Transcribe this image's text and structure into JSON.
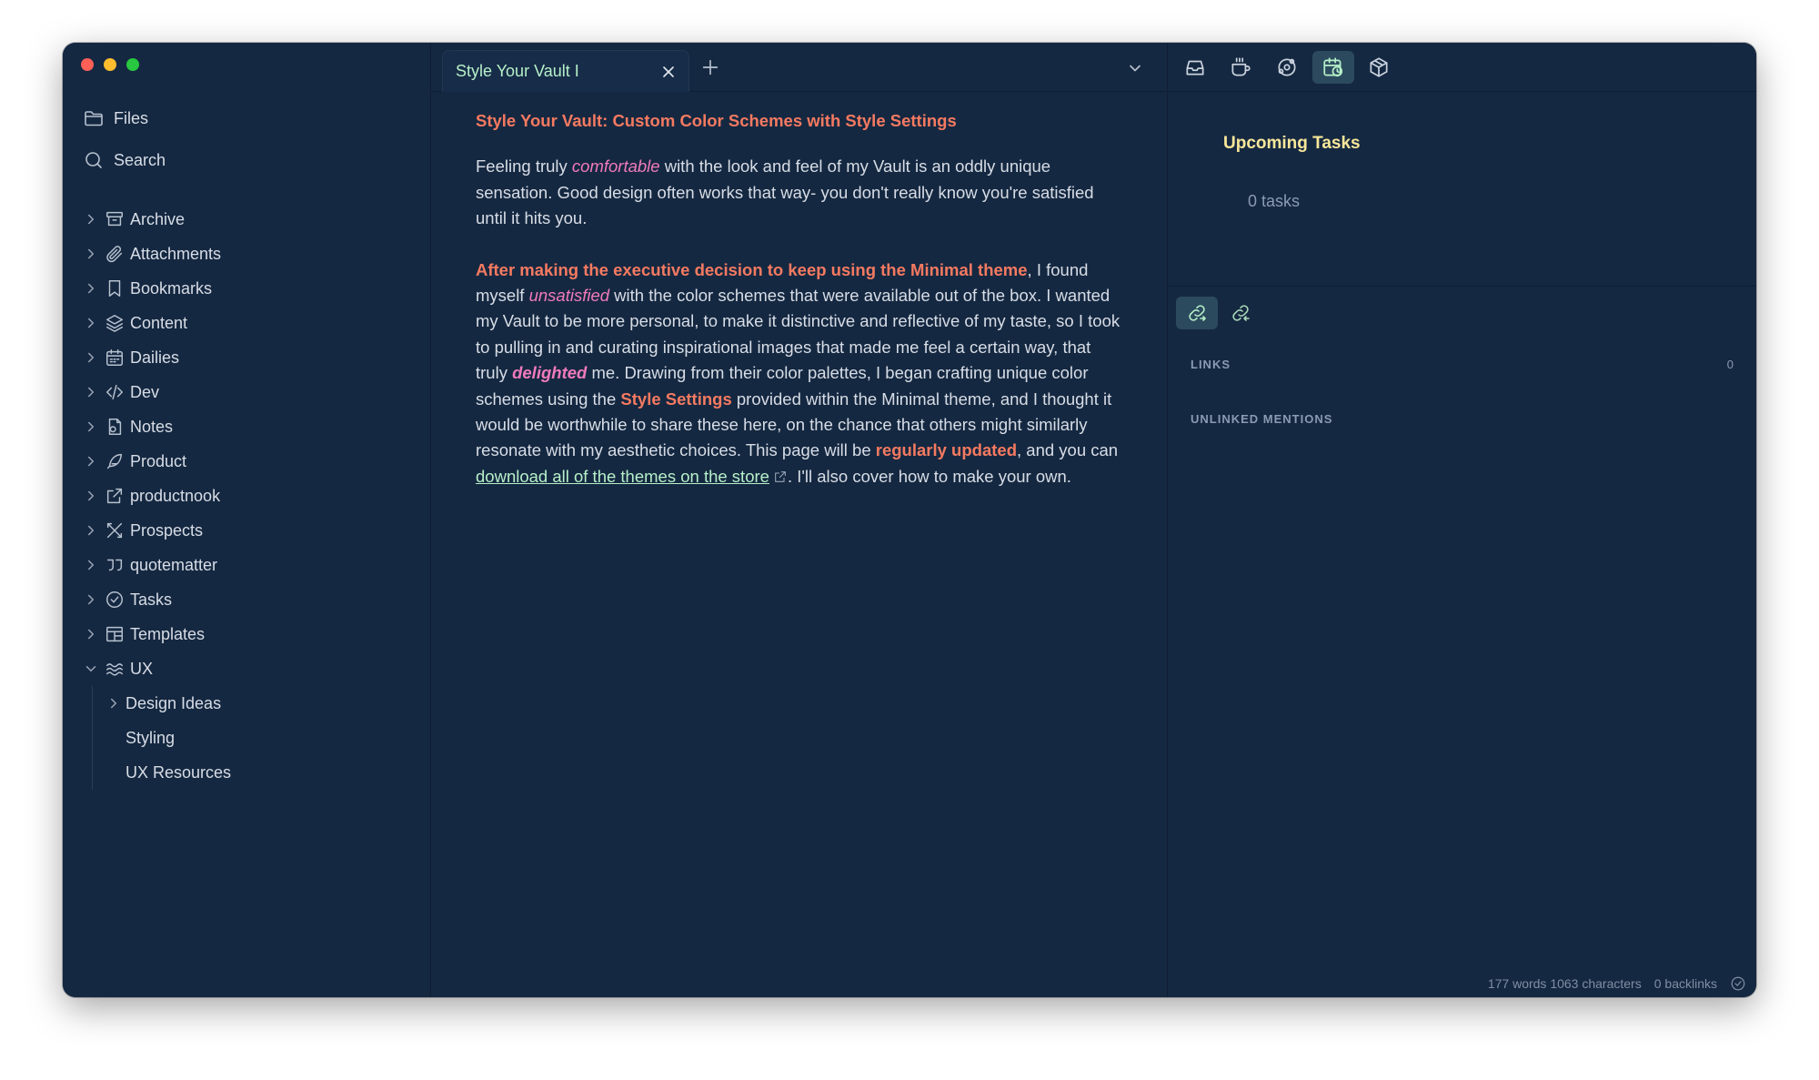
{
  "sidebar": {
    "top_items": [
      {
        "label": "Files",
        "icon": "folder-icon"
      },
      {
        "label": "Search",
        "icon": "search-icon"
      }
    ],
    "folders": [
      {
        "label": "Archive",
        "icon": "archive-icon"
      },
      {
        "label": "Attachments",
        "icon": "paperclip-icon"
      },
      {
        "label": "Bookmarks",
        "icon": "bookmark-icon"
      },
      {
        "label": "Content",
        "icon": "layers-icon"
      },
      {
        "label": "Dailies",
        "icon": "calendar-icon"
      },
      {
        "label": "Dev",
        "icon": "code-icon"
      },
      {
        "label": "Notes",
        "icon": "note-icon"
      },
      {
        "label": "Product",
        "icon": "feather-icon"
      },
      {
        "label": "productnook",
        "icon": "external-link-icon"
      },
      {
        "label": "Prospects",
        "icon": "tools-icon"
      },
      {
        "label": "quotematter",
        "icon": "quote-icon"
      },
      {
        "label": "Tasks",
        "icon": "check-circle-icon"
      },
      {
        "label": "Templates",
        "icon": "layout-icon"
      },
      {
        "label": "UX",
        "icon": "waves-icon"
      }
    ],
    "ux_children": [
      {
        "label": "Design Ideas"
      },
      {
        "label": "Styling"
      },
      {
        "label": "UX Resources"
      }
    ]
  },
  "tabs": [
    {
      "title": "Style Your Vault I"
    }
  ],
  "document": {
    "heading": "Style Your Vault: Custom Color Schemes with Style Settings",
    "p1": {
      "t1": "Feeling truly ",
      "em1": "comfortable",
      "t2": " with the look and feel of my Vault is an oddly unique sensation. Good design often works that way- you don't really know you're satisfied until it hits you."
    },
    "p2": {
      "strong1": "After making the executive decision to keep using the Minimal theme",
      "t1": ", I found myself ",
      "em1": "unsatisfied",
      "t2": " with the color schemes that were available out of the box. I wanted my Vault to be more personal, to make it distinctive and reflective of my taste, so I took to pulling in and curating inspirational images that made me feel a certain way, that truly ",
      "em2": "delighted",
      "t3": " me. Drawing from their color palettes, I began crafting unique color schemes using the ",
      "strong2": "Style Settings",
      "t4": " provided within the Minimal theme, and I thought it would be worthwhile to share these here, on the chance that others might similarly resonate with my aesthetic choices. This page will be ",
      "strong3": "regularly updated",
      "t5": ", and you can ",
      "link": "download all of the themes on the store",
      "t6": ". I'll also cover how to make your own."
    }
  },
  "right_panel": {
    "toolbar_icons": [
      "inbox-icon",
      "coffee-icon",
      "graph-icon",
      "calendar-clock-icon",
      "package-icon"
    ],
    "upcoming_title": "Upcoming Tasks",
    "upcoming_count": "0 tasks",
    "links_label": "LINKS",
    "links_count": "0",
    "unlinked_label": "UNLINKED MENTIONS"
  },
  "status_bar": {
    "words": "177 words",
    "characters": "1063 characters",
    "backlinks": "0 backlinks"
  },
  "colors": {
    "background": "#152841",
    "heading_accent": "#f57a61",
    "emphasis": "#f07bbb",
    "link_and_tab": "#b6f0c9",
    "upcoming_title": "#f8e79a"
  }
}
